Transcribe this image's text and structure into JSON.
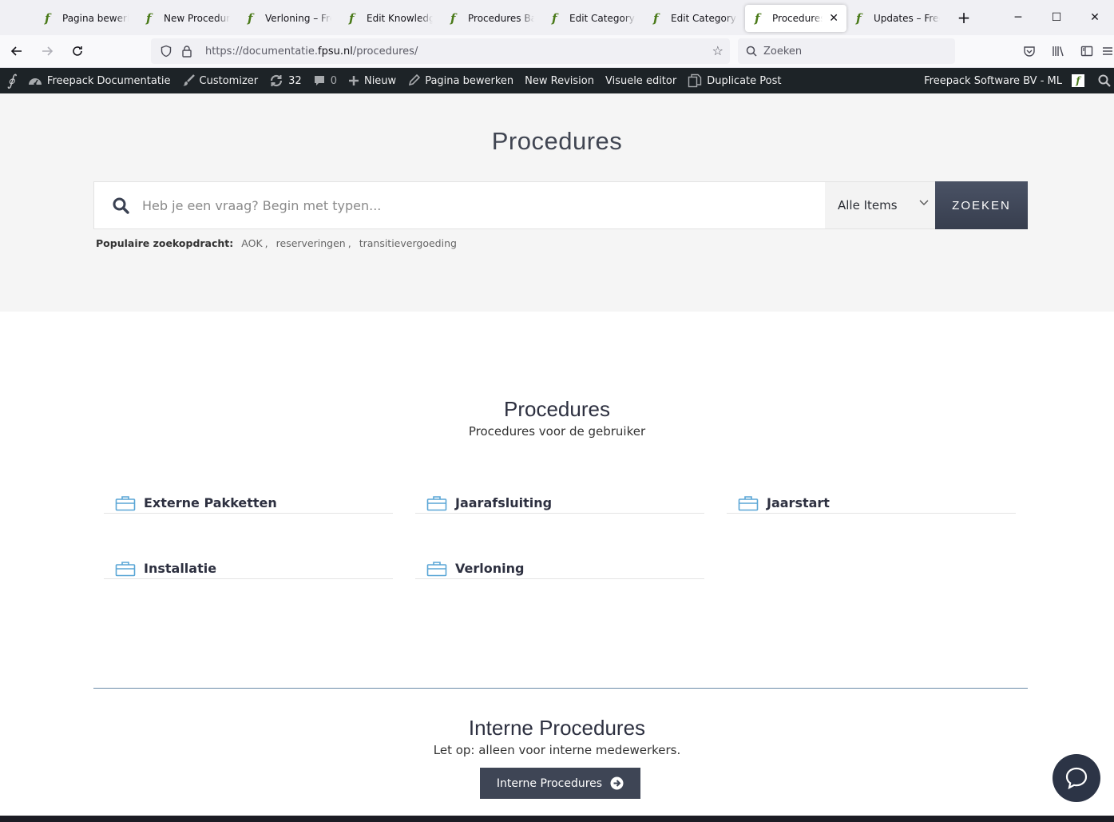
{
  "browser": {
    "tabs": [
      {
        "title": "Pagina bewerken",
        "active": false
      },
      {
        "title": "New Procedures",
        "active": false
      },
      {
        "title": "Verloning – Freepack",
        "active": false
      },
      {
        "title": "Edit Knowledge Base",
        "active": false
      },
      {
        "title": "Procedures Base",
        "active": false
      },
      {
        "title": "Edit Category ‹ Freepack",
        "active": false
      },
      {
        "title": "Edit Category ‹ Freepack",
        "active": false
      },
      {
        "title": "Procedures – Freepack",
        "active": true
      },
      {
        "title": "Updates – Freepack",
        "active": false
      }
    ],
    "new_tab": "+",
    "url_prefix": "https://documentatie.",
    "url_domain": "fpsu.nl",
    "url_path": "/procedures/",
    "search_placeholder": "Zoeken"
  },
  "adminbar": {
    "site_name": "Freepack Documentatie",
    "customizer": "Customizer",
    "updates_count": "32",
    "comments_count": "0",
    "new": "Nieuw",
    "edit_page": "Pagina bewerken",
    "new_revision": "New Revision",
    "visual_editor": "Visuele editor",
    "duplicate_post": "Duplicate Post",
    "user": "Freepack Software BV - ML",
    "avatar_letter": "f"
  },
  "hero": {
    "title": "Procedures",
    "search_placeholder": "Heb je een vraag? Begin met typen...",
    "select_value": "Alle Items",
    "search_button": "ZOEKEN",
    "popular_label": "Populaire zoekopdracht:",
    "popular_tags": [
      "AOK",
      "reserveringen",
      "transitievergoeding"
    ]
  },
  "procedures": {
    "title": "Procedures",
    "subtitle": "Procedures voor de gebruiker",
    "categories": [
      "Externe Pakketten",
      "Jaarafsluiting",
      "Jaarstart",
      "Installatie",
      "Verloning"
    ]
  },
  "internal": {
    "title": "Interne Procedures",
    "subtitle": "Let op: alleen voor interne medewerkers.",
    "button": "Interne Procedures"
  },
  "colors": {
    "accent": "#3e4555",
    "icon": "#5aa6d6",
    "adminbar": "#1d2327"
  }
}
